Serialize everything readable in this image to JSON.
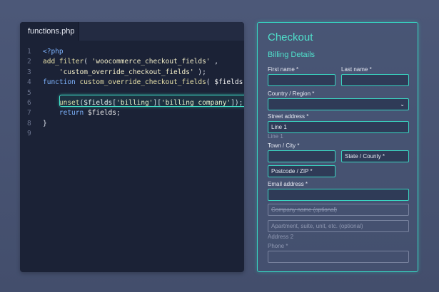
{
  "editor": {
    "tab_label": "functions.php",
    "lines": [
      {
        "n": "1",
        "parts": [
          {
            "t": "<?php",
            "c": "kw"
          }
        ]
      },
      {
        "n": "2",
        "parts": [
          {
            "t": "add_filter",
            "c": "fn"
          },
          {
            "t": "( ",
            "c": ""
          },
          {
            "t": "'woocommerce_checkout_fields'",
            "c": "str"
          },
          {
            "t": " ,",
            "c": ""
          }
        ]
      },
      {
        "n": "3",
        "parts": [
          {
            "t": "    ",
            "c": ""
          },
          {
            "t": "'custom_override_checkout_fields'",
            "c": "str"
          },
          {
            "t": " );",
            "c": ""
          }
        ]
      },
      {
        "n": "4",
        "parts": [
          {
            "t": "function ",
            "c": "kw"
          },
          {
            "t": "custom_override_checkout_fields",
            "c": "fn"
          },
          {
            "t": "( ",
            "c": ""
          },
          {
            "t": "$fields",
            "c": "var"
          },
          {
            "t": " ) {",
            "c": ""
          }
        ]
      },
      {
        "n": "5",
        "parts": []
      },
      {
        "n": "6",
        "parts": [
          {
            "t": "    ",
            "c": ""
          },
          {
            "t": "unset",
            "c": "fn"
          },
          {
            "t": "(",
            "c": ""
          },
          {
            "t": "$fields",
            "c": "var"
          },
          {
            "t": "[",
            "c": ""
          },
          {
            "t": "'billing'",
            "c": "str"
          },
          {
            "t": "][",
            "c": ""
          },
          {
            "t": "'billing_company'",
            "c": "str"
          },
          {
            "t": "]);",
            "c": ""
          }
        ]
      },
      {
        "n": "7",
        "parts": [
          {
            "t": "    ",
            "c": ""
          },
          {
            "t": "return ",
            "c": "kw"
          },
          {
            "t": "$fields",
            "c": "var"
          },
          {
            "t": ";",
            "c": ""
          }
        ]
      },
      {
        "n": "8",
        "parts": [
          {
            "t": "}",
            "c": ""
          }
        ]
      },
      {
        "n": "9",
        "parts": []
      }
    ]
  },
  "form": {
    "title": "Checkout",
    "subtitle": "Billing Details",
    "first_name_label": "First name *",
    "last_name_label": "Last name *",
    "country_label": "Country / Region *",
    "country_chevron": "⌄",
    "street_label": "Street address *",
    "street_value": "Line 1",
    "line1_caption": "Line 1",
    "town_label": "Town / City *",
    "state_value": "State / County *",
    "postcode_value": "Postcode / ZIP *",
    "email_label": "Email address *",
    "company_placeholder": "Company name (optional)",
    "apartment_placeholder": "Apartment, suite, unit, etc. (optional)",
    "address2_label": "Address 2",
    "phone_label": "Phone *"
  },
  "colors": {
    "accent": "#36d6c2",
    "editor_bg": "#1b2236",
    "page_bg": "#4c5878"
  }
}
